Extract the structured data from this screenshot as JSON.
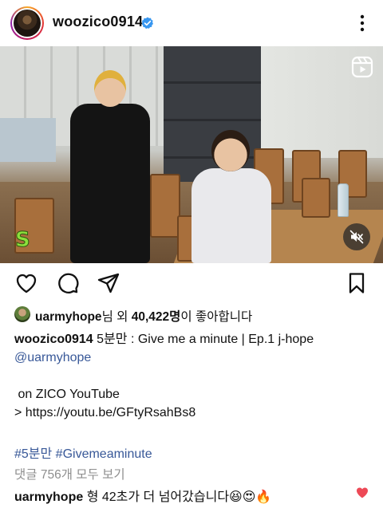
{
  "post": {
    "username": "woozico0914",
    "verified": true,
    "media": {
      "overlay_text": "S",
      "badge_icon": "reels-icon",
      "mute_icon": "speaker-muted-icon"
    },
    "actions": {
      "like_icon": "heart-outline-icon",
      "comment_icon": "comment-bubble-icon",
      "share_icon": "paper-plane-icon",
      "save_icon": "bookmark-outline-icon"
    },
    "likes": {
      "liked_by_user": "uarmyhope",
      "mid_text": "님 외 ",
      "count": "40,422명",
      "suffix": "이 좋아합니다"
    },
    "caption": {
      "username": "woozico0914",
      "text": "5분만 : Give me a minute | Ep.1 j-hope",
      "mention": "@uarmyhope",
      "line_youtube": "on ZICO YouTube",
      "link_prefix": "> ",
      "link_url": "https://youtu.be/GFtyRsahBs8",
      "hashtags": "#5분만 #Givemeaminute"
    },
    "view_comments": "댓글 756개 모두 보기",
    "top_comment": {
      "username": "uarmyhope",
      "text": "형 42초가 더 넘어갔습니다😆😍🔥"
    },
    "colors": {
      "verified_blue": "#3897f0",
      "link_blue": "#385898",
      "heart_red": "#ed4956",
      "muted_gray": "#8e8e8e"
    }
  }
}
